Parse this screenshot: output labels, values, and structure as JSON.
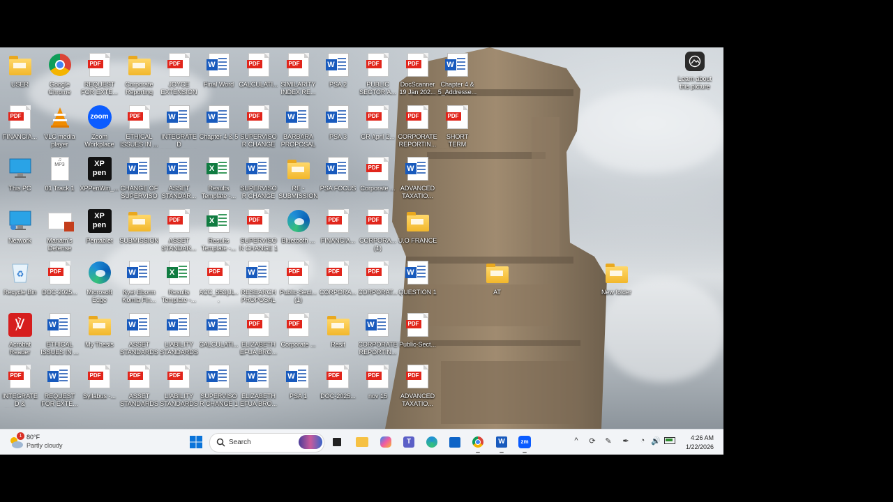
{
  "desktop": {
    "learn_about": "Learn about this picture",
    "icons": [
      {
        "type": "folder",
        "label": "USER",
        "col": 0,
        "row": 0
      },
      {
        "type": "chrome",
        "label": "Google Chrome",
        "col": 1,
        "row": 0
      },
      {
        "type": "pdf",
        "label": "REQUEST FOR EXTE...",
        "col": 2,
        "row": 0
      },
      {
        "type": "folder",
        "label": "Corporate Reporting",
        "col": 3,
        "row": 0
      },
      {
        "type": "pdf",
        "label": "JOYCE EXTENSION",
        "col": 4,
        "row": 0
      },
      {
        "type": "word",
        "label": "Final Word",
        "col": 5,
        "row": 0
      },
      {
        "type": "pdf",
        "label": "CALCULATI...",
        "col": 6,
        "row": 0
      },
      {
        "type": "pdf",
        "label": "SIMILARITY INDEX RE...",
        "col": 7,
        "row": 0
      },
      {
        "type": "word",
        "label": "PSA 2",
        "col": 8,
        "row": 0
      },
      {
        "type": "pdf",
        "label": "PUBLIC SECTOR A...",
        "col": 9,
        "row": 0
      },
      {
        "type": "pdf",
        "label": "DocScanner 19 Jan 202...",
        "col": 10,
        "row": 0
      },
      {
        "type": "word",
        "label": "Chapter 4 & 5_Addresse...",
        "col": 11,
        "row": 0
      },
      {
        "type": "pdf",
        "label": "FINANCIA...",
        "col": 0,
        "row": 1
      },
      {
        "type": "vlc",
        "label": "VLC media player",
        "col": 1,
        "row": 1
      },
      {
        "type": "zoom",
        "label": "Zoom Workplace",
        "col": 2,
        "row": 1
      },
      {
        "type": "pdf",
        "label": "ETHICAL ISSUES IN ...",
        "col": 3,
        "row": 1
      },
      {
        "type": "word",
        "label": "INTEGRATED REPORTING",
        "col": 4,
        "row": 1
      },
      {
        "type": "word",
        "label": "Chapter 4 & 5",
        "col": 5,
        "row": 1
      },
      {
        "type": "pdf",
        "label": "SUPERVISOR CHANGE",
        "col": 6,
        "row": 1
      },
      {
        "type": "word",
        "label": "BARBARA PROPOSAL",
        "col": 7,
        "row": 1
      },
      {
        "type": "word",
        "label": "PSA 3",
        "col": 8,
        "row": 1
      },
      {
        "type": "pdf",
        "label": "GR April 2...",
        "col": 9,
        "row": 1
      },
      {
        "type": "pdf",
        "label": "CORPORATE REPORTIN...",
        "col": 10,
        "row": 1
      },
      {
        "type": "pdf",
        "label": "SHORT TERM DECISION ...",
        "col": 11,
        "row": 1
      },
      {
        "type": "monitor",
        "label": "This PC",
        "col": 0,
        "row": 2
      },
      {
        "type": "mp3",
        "label": "01 Track 1",
        "col": 1,
        "row": 2
      },
      {
        "type": "xppen",
        "label": "XPPenWin_...",
        "col": 2,
        "row": 2
      },
      {
        "type": "word",
        "label": "CHANGE OF SUPERVISOR",
        "col": 3,
        "row": 2
      },
      {
        "type": "word",
        "label": "ASSET STANDAR...",
        "col": 4,
        "row": 2
      },
      {
        "type": "excel",
        "label": "Results Template -...",
        "col": 5,
        "row": 2
      },
      {
        "type": "word",
        "label": "SUPERVISOR CHANGE",
        "col": 6,
        "row": 2
      },
      {
        "type": "folder",
        "label": "RE - SUBMISSION",
        "col": 7,
        "row": 2
      },
      {
        "type": "word",
        "label": "PSA FOCUS",
        "col": 8,
        "row": 2
      },
      {
        "type": "pdf",
        "label": "Corporate ...",
        "col": 9,
        "row": 2
      },
      {
        "type": "word",
        "label": "ADVANCED TAXATIO...",
        "col": 10,
        "row": 2
      },
      {
        "type": "network",
        "label": "Network",
        "col": 0,
        "row": 3
      },
      {
        "type": "ppt",
        "label": "Mariam's Defense",
        "col": 1,
        "row": 3
      },
      {
        "type": "xppen",
        "label": "Pentablet",
        "col": 2,
        "row": 3
      },
      {
        "type": "folder",
        "label": "SUBMISSION",
        "col": 3,
        "row": 3
      },
      {
        "type": "pdf",
        "label": "ASSET STANDAR...",
        "col": 4,
        "row": 3
      },
      {
        "type": "excel",
        "label": "Results Template -...",
        "col": 5,
        "row": 3
      },
      {
        "type": "pdf",
        "label": "SUPERVISOR CHANGE 1",
        "col": 6,
        "row": 3
      },
      {
        "type": "edge",
        "label": "Bluetooth ...",
        "col": 7,
        "row": 3
      },
      {
        "type": "pdf",
        "label": "FINANCIA...",
        "col": 8,
        "row": 3
      },
      {
        "type": "pdf",
        "label": "CORPORA... (1)",
        "col": 9,
        "row": 3
      },
      {
        "type": "folder",
        "label": "U.O FRANCE",
        "col": 10,
        "row": 3
      },
      {
        "type": "recycle",
        "label": "Recycle Bin",
        "col": 0,
        "row": 4
      },
      {
        "type": "pdf",
        "label": "DOC-2025...",
        "col": 1,
        "row": 4
      },
      {
        "type": "edge",
        "label": "Microsoft Edge",
        "col": 2,
        "row": 4
      },
      {
        "type": "word",
        "label": "Kyei Eborm Komla Fin...",
        "col": 3,
        "row": 4
      },
      {
        "type": "excel",
        "label": "Results Template -...",
        "col": 4,
        "row": 4
      },
      {
        "type": "pdf",
        "label": "ACC_553(JL...",
        "col": 5,
        "row": 4
      },
      {
        "type": "word",
        "label": "RESEARCH PROPOSAL",
        "col": 6,
        "row": 4
      },
      {
        "type": "pdf",
        "label": "Public-Sect... (1)",
        "col": 7,
        "row": 4
      },
      {
        "type": "pdf",
        "label": "CORPORA...",
        "col": 8,
        "row": 4
      },
      {
        "type": "pdf",
        "label": "CORPORAT...",
        "col": 9,
        "row": 4
      },
      {
        "type": "word",
        "label": "QUESTION 1",
        "col": 10,
        "row": 4
      },
      {
        "type": "folder",
        "label": "AT",
        "col": 12,
        "row": 4
      },
      {
        "type": "folder",
        "label": "New folder",
        "col": 15,
        "row": 4
      },
      {
        "type": "acrobat",
        "label": "Acrobat Reader",
        "col": 0,
        "row": 5
      },
      {
        "type": "word",
        "label": "ETHICAL ISSUES IN ...",
        "col": 1,
        "row": 5
      },
      {
        "type": "folder",
        "label": "My Thesis",
        "col": 2,
        "row": 5
      },
      {
        "type": "word",
        "label": "ASSET STANDARDS",
        "col": 3,
        "row": 5
      },
      {
        "type": "word",
        "label": "LIABILITY STANDARDS",
        "col": 4,
        "row": 5
      },
      {
        "type": "word",
        "label": "CALCULATI...",
        "col": 5,
        "row": 5
      },
      {
        "type": "pdf",
        "label": "ELIZABETH EFUA BRO...",
        "col": 6,
        "row": 5
      },
      {
        "type": "pdf",
        "label": "Corporate ...",
        "col": 7,
        "row": 5
      },
      {
        "type": "folder",
        "label": "Resit",
        "col": 8,
        "row": 5
      },
      {
        "type": "word",
        "label": "CORPORATE REPORTIN...",
        "col": 9,
        "row": 5
      },
      {
        "type": "pdf",
        "label": "Public-Sect...",
        "col": 10,
        "row": 5
      },
      {
        "type": "pdf",
        "label": "INTEGRATED & SUSTAIN...",
        "col": 0,
        "row": 6
      },
      {
        "type": "word",
        "label": "REQUEST FOR EXTE...",
        "col": 1,
        "row": 6
      },
      {
        "type": "pdf",
        "label": "Syllabus -...",
        "col": 2,
        "row": 6
      },
      {
        "type": "pdf",
        "label": "ASSET STANDARDS",
        "col": 3,
        "row": 6
      },
      {
        "type": "pdf",
        "label": "LIABILITY STANDARDS",
        "col": 4,
        "row": 6
      },
      {
        "type": "word",
        "label": "SUPERVISOR CHANGE 1",
        "col": 5,
        "row": 6
      },
      {
        "type": "word",
        "label": "ELIZABETH EFUA BRO...",
        "col": 6,
        "row": 6
      },
      {
        "type": "word",
        "label": "PSA 1",
        "col": 7,
        "row": 6
      },
      {
        "type": "pdf",
        "label": "DOC-2025...",
        "col": 8,
        "row": 6
      },
      {
        "type": "pdf",
        "label": "nov 15",
        "col": 9,
        "row": 6
      },
      {
        "type": "pdf",
        "label": "ADVANCED TAXATIO...",
        "col": 10,
        "row": 6
      }
    ]
  },
  "taskbar": {
    "weather_temp": "80°F",
    "weather_desc": "Partly cloudy",
    "weather_badge": "1",
    "search_label": "Search",
    "time": "4:26 AM",
    "date": "1/22/2026"
  },
  "labels": {
    "pdf": "PDF",
    "word": "W",
    "excel": "X",
    "zoom": "zoom",
    "xppen": "XP pen",
    "mp3": "MP3",
    "zm": "zm"
  }
}
